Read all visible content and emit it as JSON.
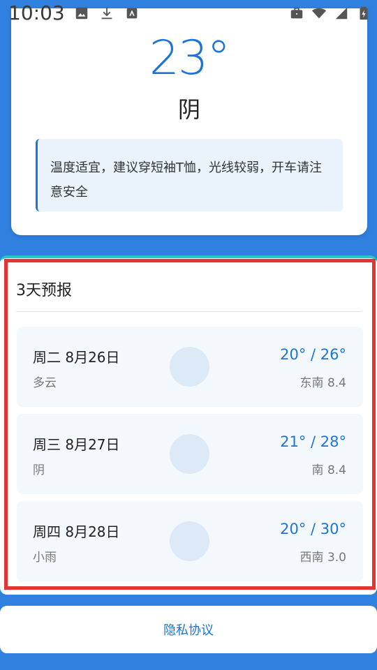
{
  "status_bar": {
    "time": "10:03",
    "left_icons": [
      "image-icon",
      "download-icon",
      "app-store-icon"
    ],
    "right_icons": [
      "briefcase-icon",
      "wifi-icon",
      "signal-icon",
      "battery-icon"
    ]
  },
  "current": {
    "temperature": "23°",
    "condition": "阴",
    "advice": "温度适宜，建议穿短袖T恤，光线较弱，开车请注意安全"
  },
  "forecast": {
    "title": "3天预报",
    "days": [
      {
        "date": "周二 8月26日",
        "condition": "多云",
        "temp": "20° / 26°",
        "wind": "东南 8.4"
      },
      {
        "date": "周三 8月27日",
        "condition": "阴",
        "temp": "21° / 28°",
        "wind": "南 8.4"
      },
      {
        "date": "周四 8月28日",
        "condition": "小雨",
        "temp": "20° / 30°",
        "wind": "西南 3.0"
      }
    ]
  },
  "footer": {
    "privacy_label": "隐私协议"
  },
  "colors": {
    "background": "#2f80df",
    "accent": "#1d74d6",
    "highlight": "#e03535",
    "card_top_border": "#27c5c8"
  }
}
